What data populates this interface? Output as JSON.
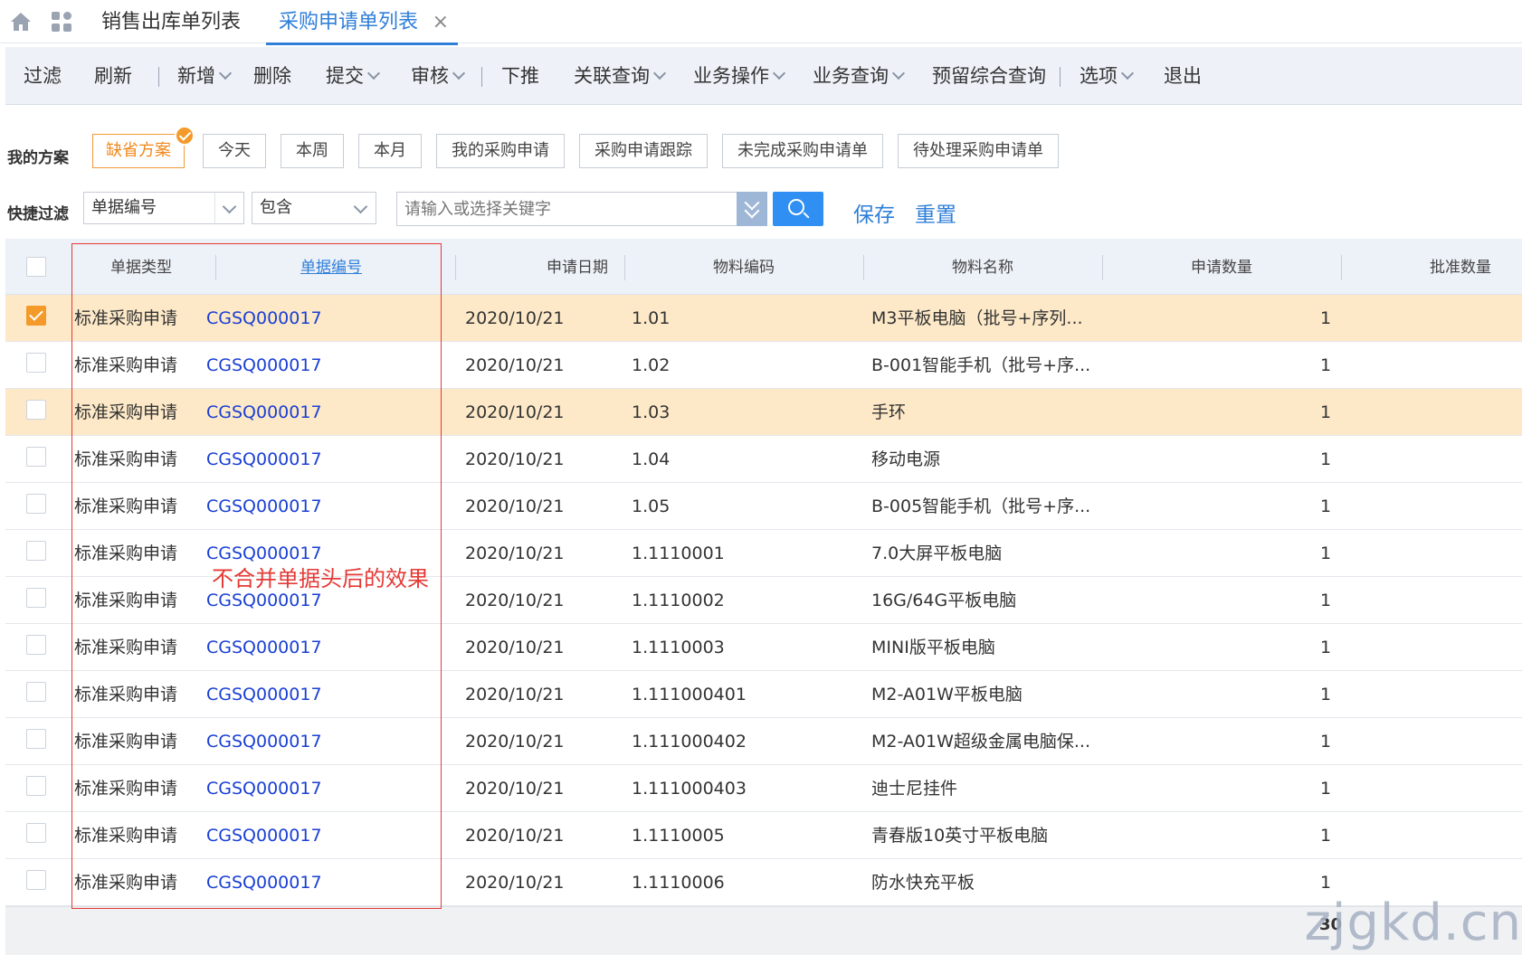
{
  "tabs": {
    "tab1": "销售出库单列表",
    "tab2": "采购申请单列表",
    "close": "×"
  },
  "toolbar": {
    "filter": "过滤",
    "refresh": "刷新",
    "add": "新增",
    "delete": "删除",
    "submit": "提交",
    "audit": "审核",
    "push_down": "下推",
    "related_query": "关联查询",
    "business_ops": "业务操作",
    "business_query": "业务查询",
    "reserve_query": "预留综合查询",
    "options": "选项",
    "exit": "退出"
  },
  "plans": {
    "label": "我的方案",
    "items": [
      "缺省方案",
      "今天",
      "本周",
      "本月",
      "我的采购申请",
      "采购申请跟踪",
      "未完成采购申请单",
      "待处理采购申请单"
    ]
  },
  "quick_filter": {
    "label": "快捷过滤",
    "field": "单据编号",
    "operator": "包含",
    "placeholder": "请输入或选择关键字",
    "save": "保存",
    "reset": "重置"
  },
  "grid": {
    "columns": [
      "单据类型",
      "单据编号",
      "申请日期",
      "物料编码",
      "物料名称",
      "申请数量",
      "批准数量"
    ],
    "rows": [
      {
        "type": "标准采购申请",
        "no": "CGSQ000017",
        "date": "2020/10/21",
        "code": "1.01",
        "name": "M3平板电脑（批号+序列...",
        "qty": "1",
        "checked": true
      },
      {
        "type": "标准采购申请",
        "no": "CGSQ000017",
        "date": "2020/10/21",
        "code": "1.02",
        "name": "B-001智能手机（批号+序...",
        "qty": "1",
        "checked": false
      },
      {
        "type": "标准采购申请",
        "no": "CGSQ000017",
        "date": "2020/10/21",
        "code": "1.03",
        "name": "手环",
        "qty": "1",
        "checked": false
      },
      {
        "type": "标准采购申请",
        "no": "CGSQ000017",
        "date": "2020/10/21",
        "code": "1.04",
        "name": "移动电源",
        "qty": "1",
        "checked": false
      },
      {
        "type": "标准采购申请",
        "no": "CGSQ000017",
        "date": "2020/10/21",
        "code": "1.05",
        "name": "B-005智能手机（批号+序...",
        "qty": "1",
        "checked": false
      },
      {
        "type": "标准采购申请",
        "no": "CGSQ000017",
        "date": "2020/10/21",
        "code": "1.1110001",
        "name": "7.0大屏平板电脑",
        "qty": "1",
        "checked": false
      },
      {
        "type": "标准采购申请",
        "no": "CGSQ000017",
        "date": "2020/10/21",
        "code": "1.1110002",
        "name": "16G/64G平板电脑",
        "qty": "1",
        "checked": false
      },
      {
        "type": "标准采购申请",
        "no": "CGSQ000017",
        "date": "2020/10/21",
        "code": "1.1110003",
        "name": "MINI版平板电脑",
        "qty": "1",
        "checked": false
      },
      {
        "type": "标准采购申请",
        "no": "CGSQ000017",
        "date": "2020/10/21",
        "code": "1.111000401",
        "name": "M2-A01W平板电脑",
        "qty": "1",
        "checked": false
      },
      {
        "type": "标准采购申请",
        "no": "CGSQ000017",
        "date": "2020/10/21",
        "code": "1.111000402",
        "name": "M2-A01W超级金属电脑保...",
        "qty": "1",
        "checked": false
      },
      {
        "type": "标准采购申请",
        "no": "CGSQ000017",
        "date": "2020/10/21",
        "code": "1.111000403",
        "name": "迪士尼挂件",
        "qty": "1",
        "checked": false
      },
      {
        "type": "标准采购申请",
        "no": "CGSQ000017",
        "date": "2020/10/21",
        "code": "1.1110005",
        "name": "青春版10英寸平板电脑",
        "qty": "1",
        "checked": false
      },
      {
        "type": "标准采购申请",
        "no": "CGSQ000017",
        "date": "2020/10/21",
        "code": "1.1110006",
        "name": "防水快充平板",
        "qty": "1",
        "checked": false
      }
    ]
  },
  "pagination": {
    "page_size": "30"
  },
  "annotation": "不合并单据头后的效果",
  "watermark": "zjgkd.cn",
  "colors": {
    "accent": "#2f7fd9",
    "highlight_row": "#fde9c7",
    "active_plan": "#f0891e",
    "annotation": "#e53935"
  }
}
